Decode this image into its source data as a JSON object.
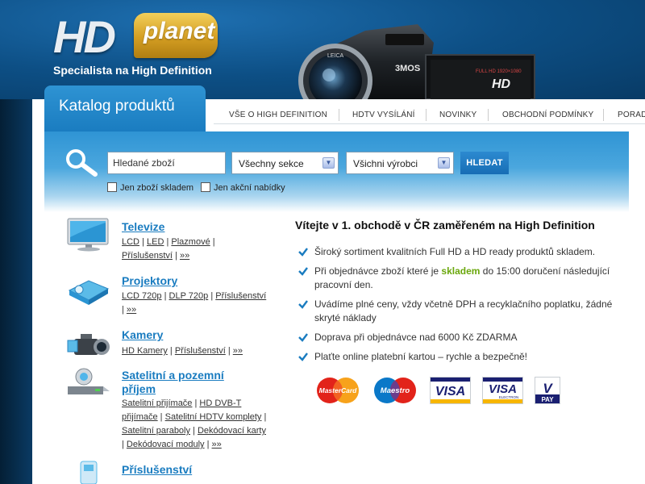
{
  "header": {
    "logo_hd": "HD",
    "logo_planet": "planet",
    "tagline": "Specialista na High Definition",
    "camera_brand": "3MOS",
    "camera_lens": "LEICA",
    "camera_screen_text": "FULL HD 1920×1080",
    "camera_screen_logo": "HD"
  },
  "catalog_tab": {
    "label": "Katalog produktů"
  },
  "nav": {
    "items": [
      {
        "label": "VŠE O HIGH DEFINITION"
      },
      {
        "label": "HDTV VYSÍLÁNÍ"
      },
      {
        "label": "NOVINKY"
      },
      {
        "label": "OBCHODNÍ PODMÍNKY"
      },
      {
        "label": "PORAD"
      }
    ]
  },
  "search": {
    "input_value": "Hledané zboží",
    "section_select": "Všechny sekce",
    "maker_select": "Všichni výrobci",
    "button_label": "HLEDAT",
    "only_in_stock": "Jen zboží skladem",
    "only_offers": "Jen akční nabídky"
  },
  "categories": [
    {
      "title": "Televize",
      "links": [
        "LCD",
        "LED",
        "Plazmové",
        "Příslušenství",
        "»»"
      ]
    },
    {
      "title": "Projektory",
      "links": [
        "LCD 720p",
        "DLP 720p",
        "Příslušenství",
        "»»"
      ]
    },
    {
      "title": "Kamery",
      "links": [
        "HD Kamery",
        "Příslušenství",
        "»»"
      ]
    },
    {
      "title": "Satelitní a pozemní příjem",
      "links": [
        "Satelitní přijímače",
        "HD DVB-T přijímače",
        "Satelitní HDTV komplety",
        "Satelitní paraboly",
        "Dekódovací karty",
        "Dekódovací moduly",
        "»»"
      ]
    },
    {
      "title": "Příslušenství",
      "links": []
    }
  ],
  "welcome": {
    "title": "Vítejte v 1. obchodě v ČR zaměřeném na High Definition",
    "features": [
      {
        "text": "Široký sortiment kvalitních Full HD a HD ready produktů skladem."
      },
      {
        "before": "Při objednávce zboží které je ",
        "highlight": "skladem",
        "after": " do 15:00 doručení následující pracovní den."
      },
      {
        "text": "Uvádíme plné ceny, vždy včetně DPH a recyklačního poplatku, žádné skryté náklady"
      },
      {
        "text": "Doprava při objednávce nad 6000 Kč ZDARMA"
      },
      {
        "text": "Plaťte online platební kartou – rychle a bezpečně!"
      }
    ]
  },
  "payment_cards": {
    "mastercard": "MasterCard",
    "maestro": "Maestro",
    "visa": "VISA",
    "visa_electron": "VISA",
    "visa_electron_sub": "ELECTRON",
    "vpay_v": "V",
    "vpay_label": "PAY"
  },
  "colors": {
    "accent_blue": "#1a7cc0",
    "highlight_green": "#6aa70c",
    "logo_gold": "#d49e22",
    "header_blue": "#0d4f85"
  }
}
